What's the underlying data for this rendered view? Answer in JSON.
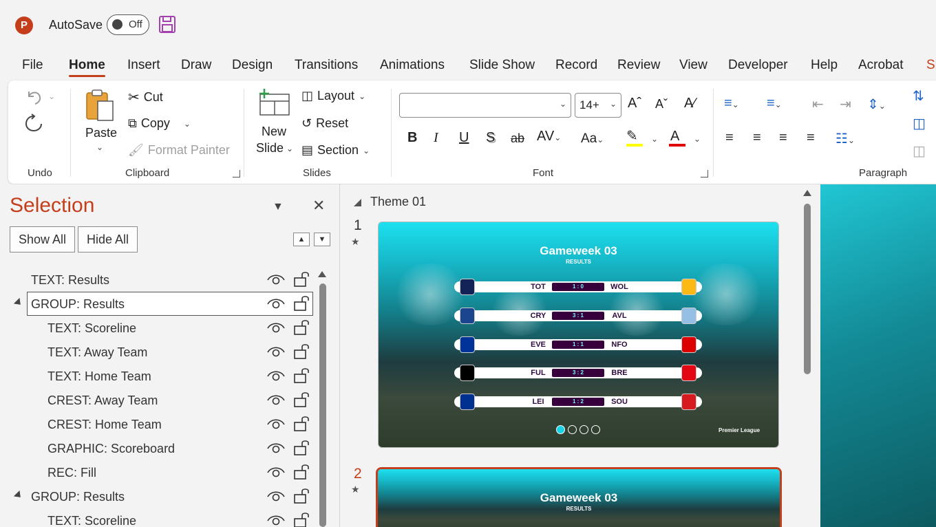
{
  "titlebar": {
    "app_logo": "P",
    "autosave_label": "AutoSave",
    "autosave_state": "Off",
    "save_icon": "floppy-disk-icon"
  },
  "tabs": [
    "File",
    "Home",
    "Insert",
    "Draw",
    "Design",
    "Transitions",
    "Animations",
    "Slide Show",
    "Record",
    "Review",
    "View",
    "Developer",
    "Help",
    "Acrobat",
    "Sh"
  ],
  "active_tab": "Home",
  "ribbon": {
    "undo": {
      "label": "Undo"
    },
    "clipboard": {
      "label": "Clipboard",
      "paste": "Paste",
      "cut": "Cut",
      "copy": "Copy",
      "format_painter": "Format Painter"
    },
    "slides": {
      "label": "Slides",
      "new_slide_line1": "New",
      "new_slide_line2": "Slide",
      "layout": "Layout",
      "reset": "Reset",
      "section": "Section"
    },
    "font": {
      "label": "Font",
      "font_name": "",
      "font_size": "14+"
    },
    "paragraph": {
      "label": "Paragraph"
    },
    "colors": {
      "highlight": "#ffff00",
      "font_color": "#e00000"
    }
  },
  "selection_pane": {
    "title": "Selection",
    "show_all": "Show All",
    "hide_all": "Hide All",
    "items": [
      {
        "name": "TEXT: Results",
        "indent": 0,
        "group": false,
        "selected": false
      },
      {
        "name": "GROUP: Results",
        "indent": 0,
        "group": true,
        "selected": true
      },
      {
        "name": "TEXT: Scoreline",
        "indent": 1,
        "group": false,
        "selected": false
      },
      {
        "name": "TEXT: Away Team",
        "indent": 1,
        "group": false,
        "selected": false
      },
      {
        "name": "TEXT: Home Team",
        "indent": 1,
        "group": false,
        "selected": false
      },
      {
        "name": "CREST: Away Team",
        "indent": 1,
        "group": false,
        "selected": false
      },
      {
        "name": "CREST: Home Team",
        "indent": 1,
        "group": false,
        "selected": false
      },
      {
        "name": "GRAPHIC: Scoreboard",
        "indent": 1,
        "group": false,
        "selected": false
      },
      {
        "name": "REC: Fill",
        "indent": 1,
        "group": false,
        "selected": false
      },
      {
        "name": "GROUP: Results",
        "indent": 0,
        "group": true,
        "selected": false
      },
      {
        "name": "TEXT: Scoreline",
        "indent": 1,
        "group": false,
        "selected": false
      }
    ]
  },
  "slides_panel": {
    "section": "Theme 01",
    "slides": [
      {
        "number": "1",
        "title": "Gameweek 03",
        "subtitle": "RESULTS",
        "active": false,
        "fixtures": [
          {
            "home": "TOT",
            "score": "1 : 0",
            "away": "WOL",
            "home_color": "#132257",
            "away_color": "#fdb913"
          },
          {
            "home": "CRY",
            "score": "3 : 1",
            "away": "AVL",
            "home_color": "#1b458f",
            "away_color": "#95bfe5"
          },
          {
            "home": "EVE",
            "score": "1 : 1",
            "away": "NFO",
            "home_color": "#003399",
            "away_color": "#dd0000"
          },
          {
            "home": "FUL",
            "score": "3 : 2",
            "away": "BRE",
            "home_color": "#000000",
            "away_color": "#e30613"
          },
          {
            "home": "LEI",
            "score": "1 : 2",
            "away": "SOU",
            "home_color": "#003090",
            "away_color": "#d71920"
          }
        ],
        "page_dots": 4,
        "active_dot": 0,
        "logo": "Premier League"
      },
      {
        "number": "2",
        "title": "Gameweek 03",
        "subtitle": "RESULTS",
        "active": true
      }
    ]
  }
}
